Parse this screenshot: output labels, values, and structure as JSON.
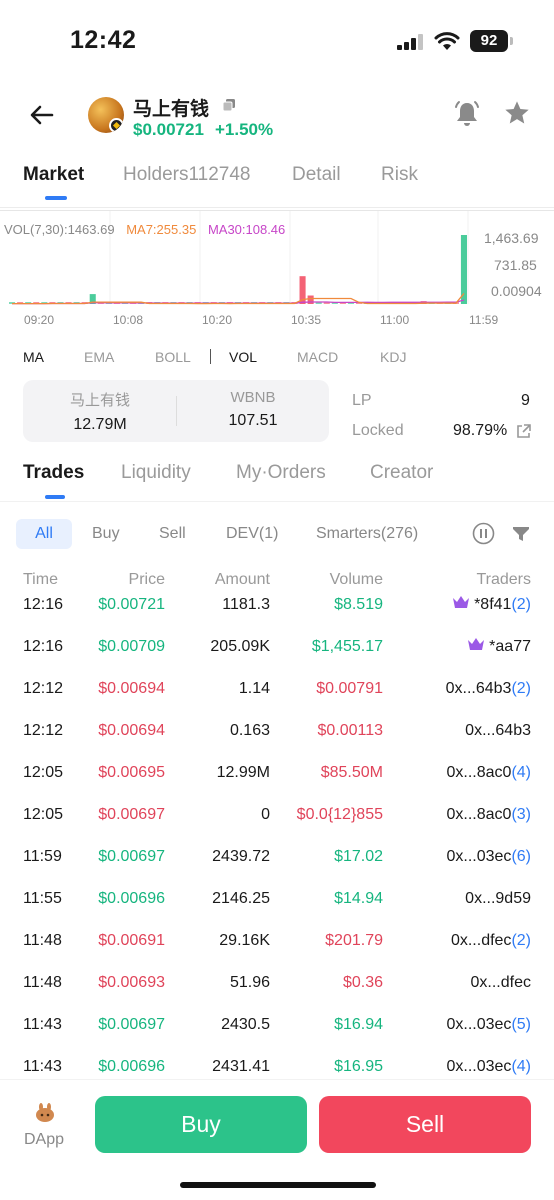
{
  "status_bar": {
    "time": "12:42",
    "battery": "92"
  },
  "token": {
    "name": "马上有钱",
    "price": "$0.00721",
    "change": "+1.50%"
  },
  "main_tabs": [
    {
      "label": "Market",
      "active": true
    },
    {
      "label": "Holders112748",
      "active": false
    },
    {
      "label": "Detail",
      "active": false
    },
    {
      "label": "Risk",
      "active": false
    }
  ],
  "chart": {
    "legend": {
      "vol": "VOL(7,30):1463.69",
      "ma7": "MA7:255.35",
      "ma30": "MA30:108.46"
    },
    "y_ticks": [
      "1,463.69",
      "731.85",
      "0.00904"
    ],
    "x_ticks": [
      "09:20",
      "10:08",
      "10:20",
      "10:35",
      "11:00",
      "11:59"
    ],
    "colors": {
      "up": "#2cc38a",
      "down": "#f2475d",
      "ma7": "#f08a3c",
      "ma30": "#c746c8"
    }
  },
  "chart_data": {
    "type": "bar",
    "title": "VOL(7,30):1463.69",
    "series": [
      {
        "name": "VOL",
        "values": [
          8,
          10,
          6,
          12,
          9,
          15,
          11,
          7,
          9,
          14,
          210,
          12,
          9,
          10,
          8,
          11,
          13,
          9,
          8,
          12,
          10,
          7,
          9,
          11,
          8,
          10,
          12,
          9,
          8,
          10,
          11,
          9,
          13,
          10,
          8,
          9,
          590,
          180,
          12,
          10,
          9,
          14,
          8,
          11,
          10,
          9,
          12,
          15,
          11,
          9,
          10,
          60,
          12,
          14,
          10,
          11,
          1463.69
        ]
      },
      {
        "name": "MA7",
        "values": [
          255.35
        ]
      },
      {
        "name": "MA30",
        "values": [
          108.46
        ]
      }
    ],
    "ylim": [
      0.00904,
      1463.69
    ],
    "x_tick_labels": [
      "09:20",
      "10:08",
      "10:20",
      "10:35",
      "11:00",
      "11:59"
    ]
  },
  "indicators": [
    {
      "label": "MA",
      "active": true
    },
    {
      "label": "EMA",
      "active": false
    },
    {
      "label": "BOLL",
      "active": false
    },
    {
      "label": "VOL",
      "active": true
    },
    {
      "label": "MACD",
      "active": false
    },
    {
      "label": "KDJ",
      "active": false
    }
  ],
  "pool": {
    "token_a_label": "马上有钱",
    "token_a_value": "12.79M",
    "token_b_label": "WBNB",
    "token_b_value": "107.51",
    "lp_label": "LP",
    "lp_value": "9",
    "locked_label": "Locked",
    "locked_value": "98.79%"
  },
  "trade_tabs": [
    {
      "label": "Trades",
      "active": true
    },
    {
      "label": "Liquidity",
      "active": false
    },
    {
      "label": "My·Orders",
      "active": false
    },
    {
      "label": "Creator",
      "active": false
    }
  ],
  "filters": [
    {
      "label": "All",
      "active": true
    },
    {
      "label": "Buy",
      "active": false
    },
    {
      "label": "Sell",
      "active": false
    },
    {
      "label": "DEV(1)",
      "active": false
    },
    {
      "label": "Smarters(276)",
      "active": false
    }
  ],
  "table": {
    "headers": [
      "Time",
      "Price",
      "Amount",
      "Volume",
      "Traders"
    ],
    "rows": [
      {
        "time": "12:16",
        "price": "$0.00721",
        "amount": "1181.3",
        "volume": "$8.519",
        "trader": "*8f41",
        "count": "(2)",
        "side": "buy",
        "crown": true
      },
      {
        "time": "12:16",
        "price": "$0.00709",
        "amount": "205.09K",
        "volume": "$1,455.17",
        "trader": "*aa77",
        "count": "",
        "side": "buy",
        "crown": true
      },
      {
        "time": "12:12",
        "price": "$0.00694",
        "amount": "1.14",
        "volume": "$0.00791",
        "trader": "0x...64b3",
        "count": "(2)",
        "side": "sell",
        "crown": false
      },
      {
        "time": "12:12",
        "price": "$0.00694",
        "amount": "0.163",
        "volume": "$0.00113",
        "trader": "0x...64b3",
        "count": "",
        "side": "sell",
        "crown": false
      },
      {
        "time": "12:05",
        "price": "$0.00695",
        "amount": "12.99M",
        "volume": "$85.50M",
        "trader": "0x...8ac0",
        "count": "(4)",
        "side": "sell",
        "crown": false
      },
      {
        "time": "12:05",
        "price": "$0.00697",
        "amount": "0",
        "volume": "$0.0{12}855",
        "trader": "0x...8ac0",
        "count": "(3)",
        "side": "sell",
        "crown": false
      },
      {
        "time": "11:59",
        "price": "$0.00697",
        "amount": "2439.72",
        "volume": "$17.02",
        "trader": "0x...03ec",
        "count": "(6)",
        "side": "buy",
        "crown": false
      },
      {
        "time": "11:55",
        "price": "$0.00696",
        "amount": "2146.25",
        "volume": "$14.94",
        "trader": "0x...9d59",
        "count": "",
        "side": "buy",
        "crown": false
      },
      {
        "time": "11:48",
        "price": "$0.00691",
        "amount": "29.16K",
        "volume": "$201.79",
        "trader": "0x...dfec",
        "count": "(2)",
        "side": "sell",
        "crown": false
      },
      {
        "time": "11:48",
        "price": "$0.00693",
        "amount": "51.96",
        "volume": "$0.36",
        "trader": "0x...dfec",
        "count": "",
        "side": "sell",
        "crown": false
      },
      {
        "time": "11:43",
        "price": "$0.00697",
        "amount": "2430.5",
        "volume": "$16.94",
        "trader": "0x...03ec",
        "count": "(5)",
        "side": "buy",
        "crown": false
      },
      {
        "time": "11:43",
        "price": "$0.00696",
        "amount": "2431.41",
        "volume": "$16.95",
        "trader": "0x...03ec",
        "count": "(4)",
        "side": "buy",
        "crown": false
      }
    ]
  },
  "bottom": {
    "dapp_label": "DApp",
    "buy_label": "Buy",
    "sell_label": "Sell"
  }
}
